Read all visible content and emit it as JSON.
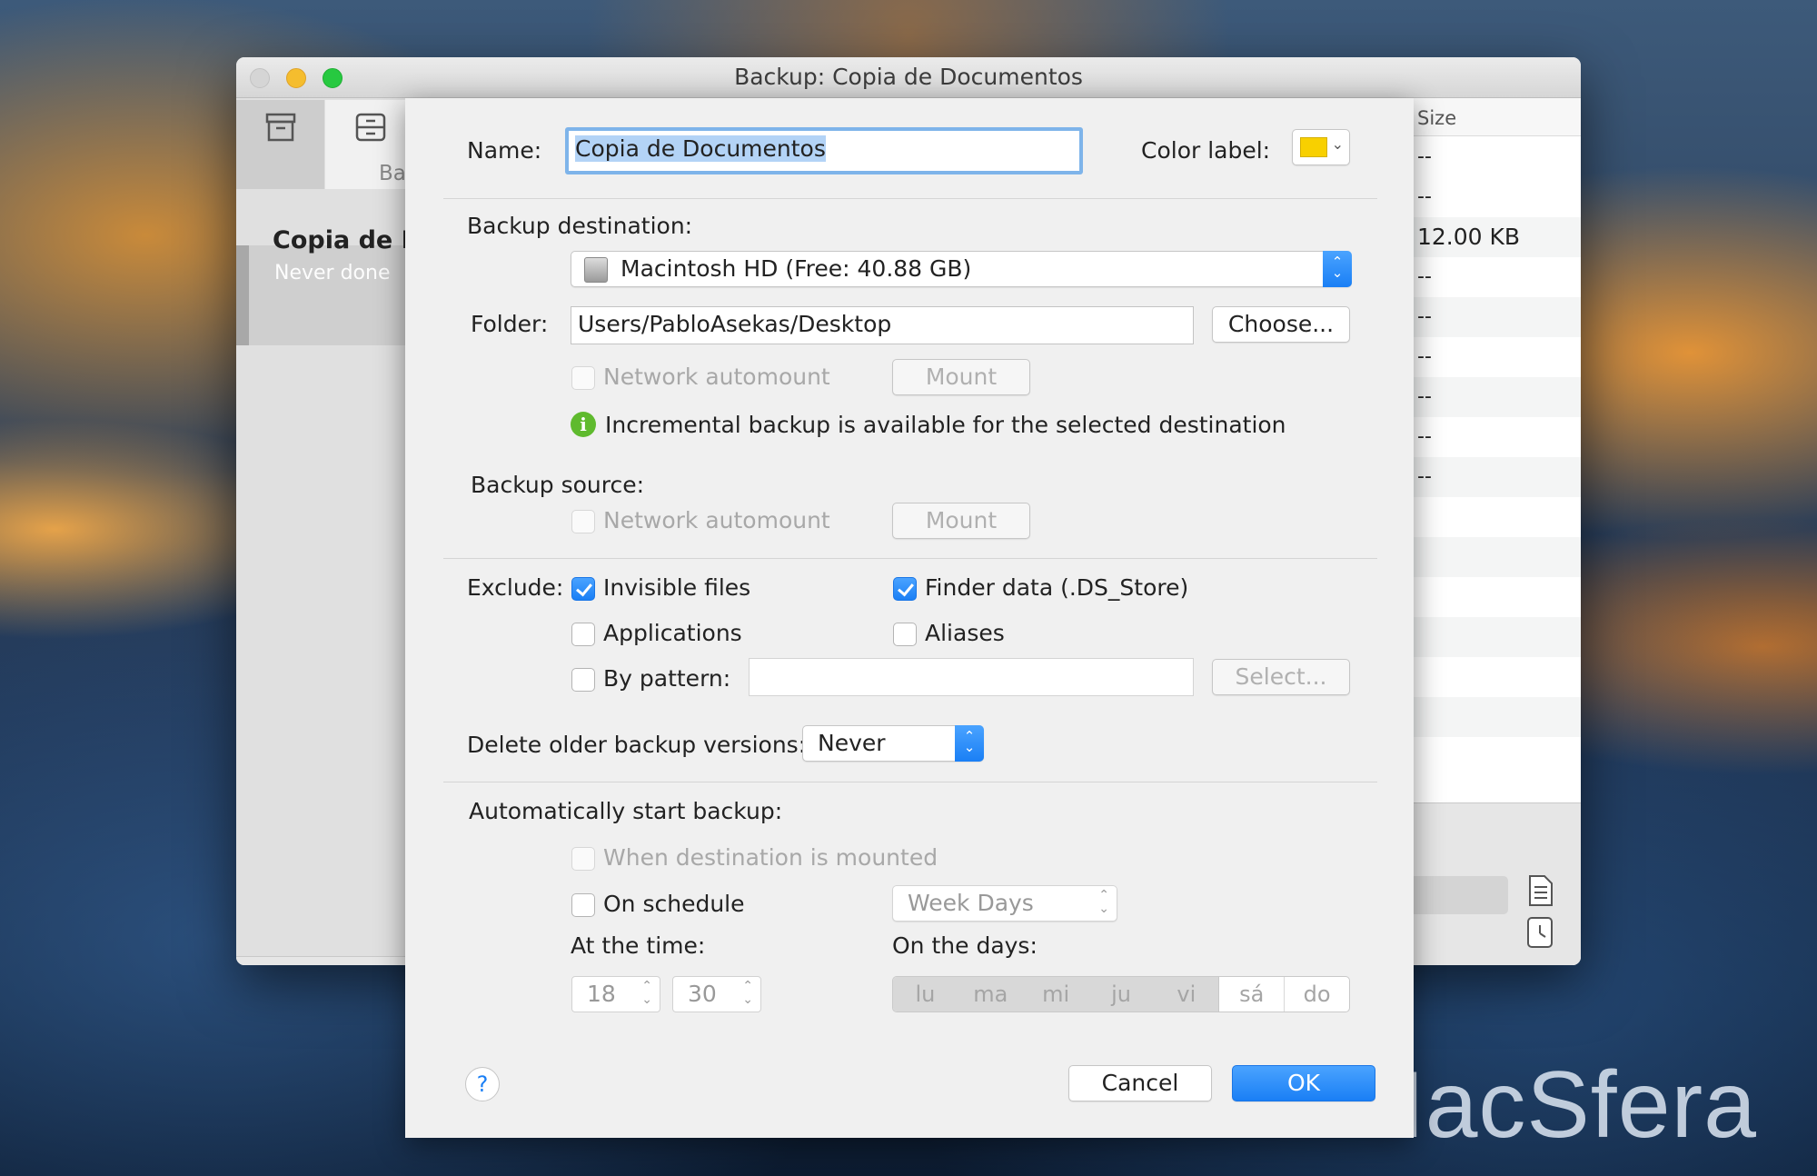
{
  "window": {
    "title": "Backup: Copia de Documentos"
  },
  "sidebar": {
    "tab_label": "Ba",
    "item_title": "Copia de D",
    "item_subtitle": "Never done",
    "add_label": "+",
    "remove_label": "—"
  },
  "right_panel": {
    "header": "Size",
    "rows": [
      "--",
      "--",
      "12.00 KB",
      "--",
      "--",
      "--",
      "--",
      "--",
      "--"
    ]
  },
  "sheet": {
    "name_label": "Name:",
    "name_value": "Copia de Documentos",
    "color_label": "Color label:",
    "color_value": "#f8d000",
    "destination_label": "Backup destination:",
    "destination_value": "Macintosh HD (Free: 40.88 GB)",
    "folder_label": "Folder:",
    "folder_value": "Users/PabloAsekas/Desktop",
    "choose_button": "Choose...",
    "network_automount_label": "Network automount",
    "mount_button": "Mount",
    "incremental_info": "Incremental backup is available for the selected destination",
    "source_label": "Backup source:",
    "source_network_automount_label": "Network automount",
    "source_mount_button": "Mount",
    "exclude_label": "Exclude:",
    "exclude_invisible": "Invisible files",
    "exclude_finder": "Finder data (.DS_Store)",
    "exclude_applications": "Applications",
    "exclude_aliases": "Aliases",
    "exclude_pattern": "By pattern:",
    "pattern_value": "",
    "select_button": "Select...",
    "delete_older_label": "Delete older backup versions:",
    "delete_older_value": "Never",
    "auto_start_label": "Automatically start backup:",
    "when_mounted_label": "When destination is mounted",
    "on_schedule_label": "On schedule",
    "schedule_value": "Week Days",
    "at_time_label": "At the time:",
    "hour_value": "18",
    "minute_value": "30",
    "on_days_label": "On the days:",
    "days": [
      "lu",
      "ma",
      "mi",
      "ju",
      "vi",
      "sá",
      "do"
    ],
    "help_label": "?",
    "cancel_button": "Cancel",
    "ok_button": "OK"
  },
  "watermark": "MacSfera"
}
